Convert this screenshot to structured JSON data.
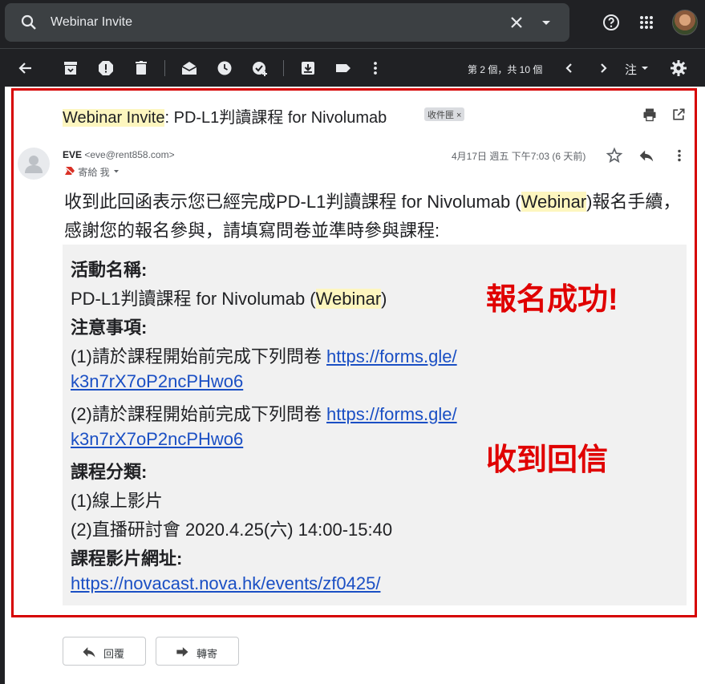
{
  "search": {
    "query": "Webinar Invite"
  },
  "toolbar": {
    "pager": "第 2 個，共 10 個",
    "input_tool": "注"
  },
  "email": {
    "subject_highlight": "Webinar Invite",
    "subject_rest": ": PD-L1判讀課程 for Nivolumab",
    "label": "收件匣 ×",
    "sender_name": "EVE",
    "sender_email": "<eve@rent858.com>",
    "to": "寄給 我",
    "date": "4月17日 週五 下午7:03 (6 天前)",
    "intro_part1": "收到此回函表示您已經完成PD-L1判讀課程 for Nivolumab (",
    "intro_highlight": "Webinar",
    "intro_part2": ")報名手續， 感謝您的報名參與，請填寫問卷並準時參與課程:"
  },
  "quote": {
    "activity_label": "活動名稱:",
    "activity_prefix": "PD-L1判讀課程 for Nivolumab (",
    "activity_highlight": "Webinar",
    "activity_suffix": ")",
    "notes_label": "注意事項:",
    "note1_text": "(1)請於課程開始前完成下列問卷 ",
    "note1_link_a": "https://forms.gle/",
    "note1_link_b": "k3n7rX7oP2ncPHwo6",
    "note2_text": "(2)請於課程開始前完成下列問卷 ",
    "note2_link_a": "https://forms.gle/",
    "note2_link_b": "k3n7rX7oP2ncPHwo6",
    "category_label": "課程分類:",
    "category1": "(1)線上影片",
    "category2": "(2)直播研討會 2020.4.25(六) 14:00-15:40",
    "video_label": "課程影片網址:",
    "video_link": "https://novacast.nova.hk/events/zf0425/"
  },
  "annotations": {
    "stamp1": "報名成功!",
    "stamp2": "收到回信"
  },
  "actions": {
    "reply": "回覆",
    "forward": "轉寄"
  },
  "colors": {
    "stamp_red": "#e00000",
    "frame_red": "#d60000",
    "link_blue": "#1a4fc4",
    "highlight": "#fdf6bf"
  }
}
